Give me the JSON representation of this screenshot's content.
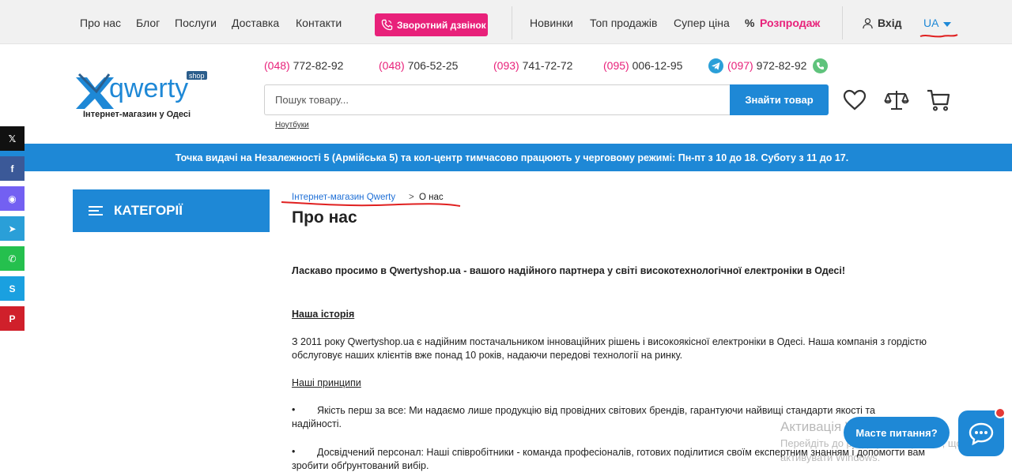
{
  "topbar": {
    "about": "Про нас",
    "blog": "Блог",
    "services": "Послуги",
    "delivery": "Доставка",
    "contacts": "Контакти",
    "callback": "Зворотний дзвінок",
    "new": "Новинки",
    "top": "Топ продажів",
    "super": "Супер ціна",
    "sale_pct": "%",
    "sale": "Розпродаж",
    "login": "Вхід",
    "lang": "UA"
  },
  "header": {
    "logo_text": "qwerty",
    "logo_badge": "shop",
    "logo_sub": "Інтернет-магазин у Одесі",
    "phones": [
      {
        "code": "(048)",
        "number": "772-82-92"
      },
      {
        "code": "(048)",
        "number": "706-52-25"
      },
      {
        "code": "(093)",
        "number": "741-72-72"
      },
      {
        "code": "(095)",
        "number": "006-12-95"
      },
      {
        "code": "(097)",
        "number": "972-82-92"
      }
    ],
    "search_placeholder": "Пошук товару...",
    "search_button": "Знайти товар",
    "search_hint": "Ноутбуки"
  },
  "strip": {
    "text": "Точка видачі на Незалежності 5 (Армійська 5) та кол-центр тимчасово працюють у черговому режимі: Пн-пт з 10 до 18. Суботу з 11 до 17."
  },
  "social": {
    "x": "𝕏",
    "facebook": "f",
    "viber": "◉",
    "telegram": "➤",
    "whatsapp": "✆",
    "skype": "S",
    "pinterest": "P"
  },
  "sidebar": {
    "categories": "КАТЕГОРІЇ"
  },
  "breadcrumb": {
    "home": "Інтернет-магазин Qwerty",
    "sep": ">",
    "current": "О нас"
  },
  "content": {
    "title": "Про нас",
    "welcome": "Ласкаво просимо в Qwertyshop.ua - вашого надійного партнера у світі високотехнологічної електроніки в Одесі!",
    "history_heading": "Наша історія",
    "history_text": "З 2011 року Qwertyshop.ua є надійним постачальником інноваційних рішень і високоякісної електроніки в Одесі. Наша компанія з гордістю обслуговує наших клієнтів вже понад 10 років, надаючи передові технології на ринку.",
    "principles_heading": "Наші принципи",
    "bullet_char": "•",
    "principle_1": "Якість перш за все: Ми надаємо лише продукцію від провідних світових брендів, гарантуючи найвищі стандарти якості та надійності.",
    "principle_2": "Досвідчений персонал: Наші співробітники - команда професіоналів, готових поділитися своїм експертним знанням і допомогти вам зробити обґрунтований вибір."
  },
  "widgets": {
    "master": "Масте питання?"
  },
  "watermark": {
    "line1": "Активація Windows",
    "line2": "Перейдіть до розділу \"Настройки\", щоб",
    "line3": "активувати Windows."
  },
  "colors": {
    "accent": "#1e88d6",
    "pink": "#e8217a",
    "annotation_red": "#e02020"
  }
}
